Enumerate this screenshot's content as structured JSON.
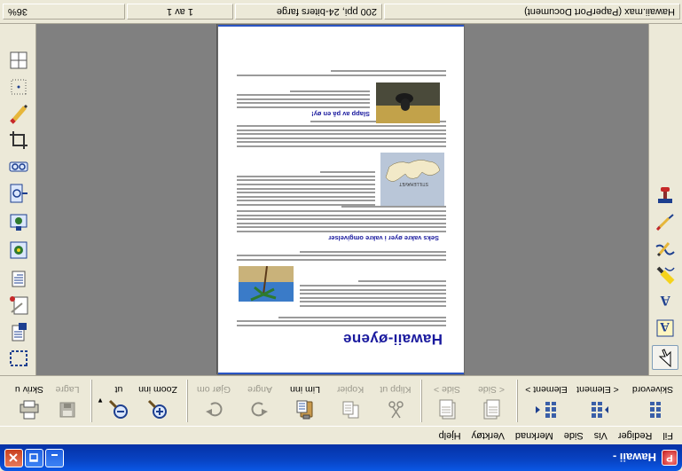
{
  "window": {
    "title": "Hawaii -",
    "app_icon": "paperport-icon"
  },
  "menu": [
    "Fil",
    "Rediger",
    "Vis",
    "Side",
    "Merknad",
    "Verktøy",
    "Hjelp"
  ],
  "toolbar": {
    "buttons": [
      {
        "label": "Skivevord",
        "icon": "grid-view-icon",
        "enabled": true
      },
      {
        "label": "< Element",
        "icon": "prev-element-icon",
        "enabled": true
      },
      {
        "label": "Element >",
        "icon": "next-element-icon",
        "enabled": true
      },
      {
        "label": "< Side",
        "icon": "prev-page-icon",
        "enabled": false
      },
      {
        "label": "Side >",
        "icon": "next-page-icon",
        "enabled": false
      },
      {
        "label": "Klipp ut",
        "icon": "scissors-icon",
        "enabled": false
      },
      {
        "label": "Kopier",
        "icon": "copy-icon",
        "enabled": false
      },
      {
        "label": "Lim inn",
        "icon": "paste-icon",
        "enabled": true
      },
      {
        "label": "Angre",
        "icon": "undo-icon",
        "enabled": false
      },
      {
        "label": "Gjør om",
        "icon": "redo-icon",
        "enabled": false
      },
      {
        "label": "Zoom inn",
        "icon": "zoom-in-icon",
        "enabled": true
      },
      {
        "label": "ut",
        "icon": "zoom-out-icon",
        "enabled": true
      },
      {
        "label": "Lagre",
        "icon": "save-icon",
        "enabled": false
      },
      {
        "label": "Skriv u",
        "icon": "print-icon",
        "enabled": true
      }
    ]
  },
  "left_tools": [
    "select-arrow-icon",
    "text-a-icon",
    "text-note-icon",
    "highlighter-icon",
    "freehand-pen-icon",
    "straight-line-icon",
    "stamp-icon"
  ],
  "right_tools": [
    "marquee-select-icon",
    "send-to-icon",
    "annotation-list-icon",
    "rotate-page-icon",
    "crop-page-icon",
    "fit-width-icon",
    "fit-page-icon",
    "enhance-icon",
    "crop-icon",
    "pencil-icon",
    "dotted-select-icon",
    "grid-icon"
  ],
  "document": {
    "title": "Hawaii-øyene",
    "headings": [
      "Seks vakre øyer i vakre omgivelser",
      "Slapp av på en øy!"
    ],
    "map_label": "STILLEHAVET"
  },
  "status": {
    "doc": "Hawaii.max (PaperPort Document)",
    "resolution": "200 ppi, 24-biters farge",
    "page": "1 av 1",
    "zoom": "36%"
  },
  "colors": {
    "titlebar": "#0843c4",
    "accent_text": "#1a1a9e"
  }
}
